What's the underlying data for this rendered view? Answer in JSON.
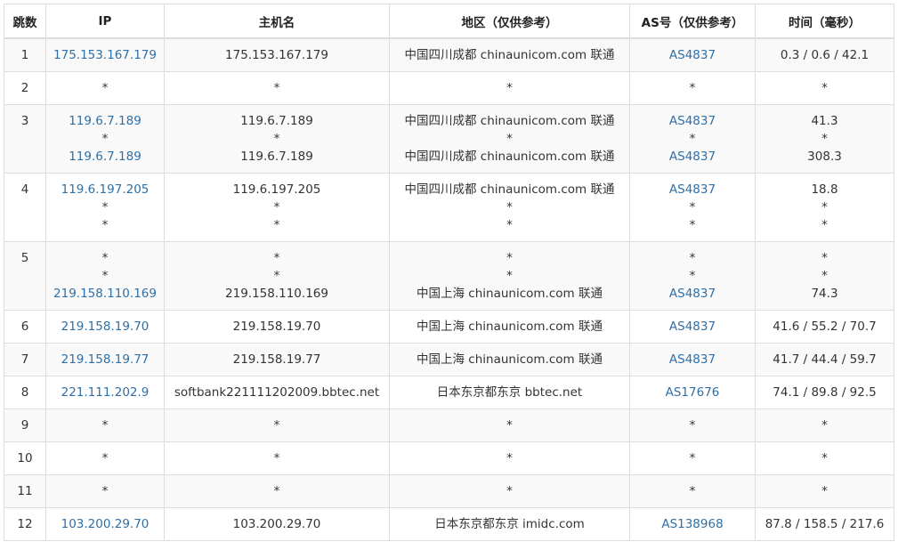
{
  "headers": [
    "跳数",
    "IP",
    "主机名",
    "地区（仅供参考）",
    "AS号（仅供参考）",
    "时间（毫秒）"
  ],
  "rows": [
    {
      "hop": "1",
      "ip": [
        "175.153.167.179"
      ],
      "host": [
        "175.153.167.179"
      ],
      "region": [
        "中国四川成都 chinaunicom.com 联通"
      ],
      "as": [
        "AS4837"
      ],
      "time": [
        "0.3 / 0.6 / 42.1"
      ]
    },
    {
      "hop": "2",
      "ip": [
        "*"
      ],
      "host": [
        "*"
      ],
      "region": [
        "*"
      ],
      "as": [
        "*"
      ],
      "time": [
        "*"
      ]
    },
    {
      "hop": "3",
      "ip": [
        "119.6.7.189",
        "*",
        "119.6.7.189"
      ],
      "host": [
        "119.6.7.189",
        "*",
        "119.6.7.189"
      ],
      "region": [
        "中国四川成都 chinaunicom.com 联通",
        "*",
        "中国四川成都 chinaunicom.com 联通"
      ],
      "as": [
        "AS4837",
        "*",
        "AS4837"
      ],
      "time": [
        "41.3",
        "*",
        "308.3"
      ]
    },
    {
      "hop": "4",
      "ip": [
        "119.6.197.205",
        "*",
        "*"
      ],
      "host": [
        "119.6.197.205",
        "*",
        "*"
      ],
      "region": [
        "中国四川成都 chinaunicom.com 联通",
        "*",
        "*"
      ],
      "as": [
        "AS4837",
        "*",
        "*"
      ],
      "time": [
        "18.8",
        "*",
        "*"
      ]
    },
    {
      "hop": "5",
      "ip": [
        "*",
        "*",
        "219.158.110.169"
      ],
      "host": [
        "*",
        "*",
        "219.158.110.169"
      ],
      "region": [
        "*",
        "*",
        "中国上海 chinaunicom.com 联通"
      ],
      "as": [
        "*",
        "*",
        "AS4837"
      ],
      "time": [
        "*",
        "*",
        "74.3"
      ]
    },
    {
      "hop": "6",
      "ip": [
        "219.158.19.70"
      ],
      "host": [
        "219.158.19.70"
      ],
      "region": [
        "中国上海 chinaunicom.com 联通"
      ],
      "as": [
        "AS4837"
      ],
      "time": [
        "41.6 / 55.2 / 70.7"
      ]
    },
    {
      "hop": "7",
      "ip": [
        "219.158.19.77"
      ],
      "host": [
        "219.158.19.77"
      ],
      "region": [
        "中国上海 chinaunicom.com 联通"
      ],
      "as": [
        "AS4837"
      ],
      "time": [
        "41.7 / 44.4 / 59.7"
      ]
    },
    {
      "hop": "8",
      "ip": [
        "221.111.202.9"
      ],
      "host": [
        "softbank221111202009.bbtec.net"
      ],
      "region": [
        "日本东京都东京 bbtec.net"
      ],
      "as": [
        "AS17676"
      ],
      "time": [
        "74.1 / 89.8 / 92.5"
      ]
    },
    {
      "hop": "9",
      "ip": [
        "*"
      ],
      "host": [
        "*"
      ],
      "region": [
        "*"
      ],
      "as": [
        "*"
      ],
      "time": [
        "*"
      ]
    },
    {
      "hop": "10",
      "ip": [
        "*"
      ],
      "host": [
        "*"
      ],
      "region": [
        "*"
      ],
      "as": [
        "*"
      ],
      "time": [
        "*"
      ]
    },
    {
      "hop": "11",
      "ip": [
        "*"
      ],
      "host": [
        "*"
      ],
      "region": [
        "*"
      ],
      "as": [
        "*"
      ],
      "time": [
        "*"
      ]
    },
    {
      "hop": "12",
      "ip": [
        "103.200.29.70"
      ],
      "host": [
        "103.200.29.70"
      ],
      "region": [
        "日本东京都东京 imidc.com"
      ],
      "as": [
        "AS138968"
      ],
      "time": [
        "87.8 / 158.5 / 217.6"
      ]
    }
  ],
  "colors": {
    "link": "#2f6fa7",
    "text": "#333333",
    "border": "#dddddd",
    "stripe": "#f9f9f9"
  }
}
